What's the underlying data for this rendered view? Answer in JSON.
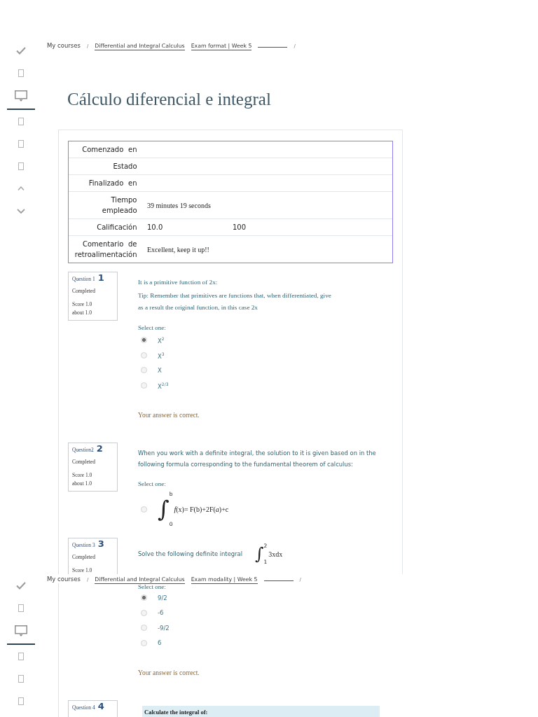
{
  "screens": [
    {
      "sidebar": [
        {
          "kind": "check",
          "selected": false
        },
        {
          "kind": "page",
          "selected": false
        },
        {
          "kind": "monitor",
          "selected": true
        },
        {
          "kind": "page",
          "selected": false
        },
        {
          "kind": "page",
          "selected": false
        },
        {
          "kind": "page",
          "selected": false
        },
        {
          "kind": "up",
          "selected": false
        },
        {
          "kind": "down",
          "selected": false
        }
      ],
      "breadcrumb": [
        {
          "kind": "text",
          "label": "My courses"
        },
        {
          "kind": "separator",
          "label": "/"
        },
        {
          "kind": "link",
          "label": "Differential and Integral Calculus"
        },
        {
          "kind": "link",
          "label": "Exam format | Week 5"
        },
        {
          "kind": "blank"
        },
        {
          "kind": "separator",
          "label": "/"
        }
      ],
      "title": "Cálculo diferencial e integral",
      "summary": [
        {
          "label": "Comenzado en",
          "kind": "blank"
        },
        {
          "label": "Estado",
          "kind": "blank"
        },
        {
          "label": "Finalizado en",
          "kind": "blank"
        },
        {
          "label": "Tiempo empleado",
          "kind": "text",
          "value": "39 minutes 19 seconds"
        },
        {
          "label": "Calificación",
          "kind": "number",
          "value": "10.0",
          "value_2": "100"
        },
        {
          "label": "Comentario de retroalimentación",
          "kind": "text",
          "value": "Excellent, keep it up!!"
        }
      ],
      "questions": [
        {
          "kind": "document",
          "info": {
            "label": "Question 1",
            "number": "1",
            "state": "Completed",
            "score": "Score 1.0",
            "out_of": "about 1.0"
          },
          "prompt": "It is a primitive function of 2x:",
          "tip": "Tip: Remember that primitives are functions that, when differentiated, give as a result the original function, in this case 2x",
          "select_label": "Select one:",
          "options": [
            {
              "label": "X$^{2}$",
              "selected": true
            },
            {
              "label": "X$^{3}$",
              "selected": false
            },
            {
              "label": "X",
              "selected": false
            },
            {
              "label": "X$^{2/3}$",
              "selected": false
            }
          ],
          "feedback": "Your answer is correct."
        },
        {
          "kind": "plain",
          "info": {
            "label": "Question2",
            "number": "2",
            "state": "Completed",
            "score": "Score 1.0",
            "out_of": "about 1.0"
          },
          "prompt": "When you work with a definite integral, the solution to it is given based on in the following formula corresponding to the fundamental theorem of calculus:",
          "select_label": "Select one:",
          "options": [
            {
              "formula": {
                "sign": "∫",
                "upper": "b",
                "lower": "0",
                "expression": "*f*(x)= F(b)+2F(*a*)+c"
              },
              "selected": false
            }
          ]
        },
        {
          "kind": "plain",
          "info": {
            "label": "Question 3",
            "number": "3",
            "state": "Completed",
            "score": "Score 1.0"
          },
          "prompt": "Solve the following definite integral",
          "prompt_formula": {
            "sign": "∫",
            "upper": "2",
            "lower": "1",
            "expression": "3xdx"
          }
        }
      ]
    },
    {
      "sidebar": [
        {
          "kind": "check",
          "selected": false
        },
        {
          "kind": "page",
          "selected": false
        },
        {
          "kind": "monitor",
          "selected": true
        },
        {
          "kind": "page",
          "selected": false
        },
        {
          "kind": "page",
          "selected": false
        },
        {
          "kind": "page",
          "selected": false
        }
      ],
      "breadcrumb": [
        {
          "kind": "text",
          "label": "My courses"
        },
        {
          "kind": "separator",
          "label": "/"
        },
        {
          "kind": "link",
          "label": "Differential and Integral Calculus"
        },
        {
          "kind": "link",
          "label": "Exam modality | Week 5"
        },
        {
          "kind": "blank"
        },
        {
          "kind": "separator",
          "label": "/"
        }
      ],
      "questions": [
        {
          "select_label": "Select one:",
          "options": [
            {
              "label": "9/2",
              "selected": true
            },
            {
              "label": "-6",
              "selected": false
            },
            {
              "label": "-9/2",
              "selected": false
            },
            {
              "label": "6",
              "selected": false
            }
          ],
          "feedback": "Your answer is correct."
        },
        {
          "kind": "document",
          "info": {
            "label": "Question 4",
            "number": "4"
          },
          "prompt_box": "Calculate the integral of:"
        }
      ]
    }
  ]
}
